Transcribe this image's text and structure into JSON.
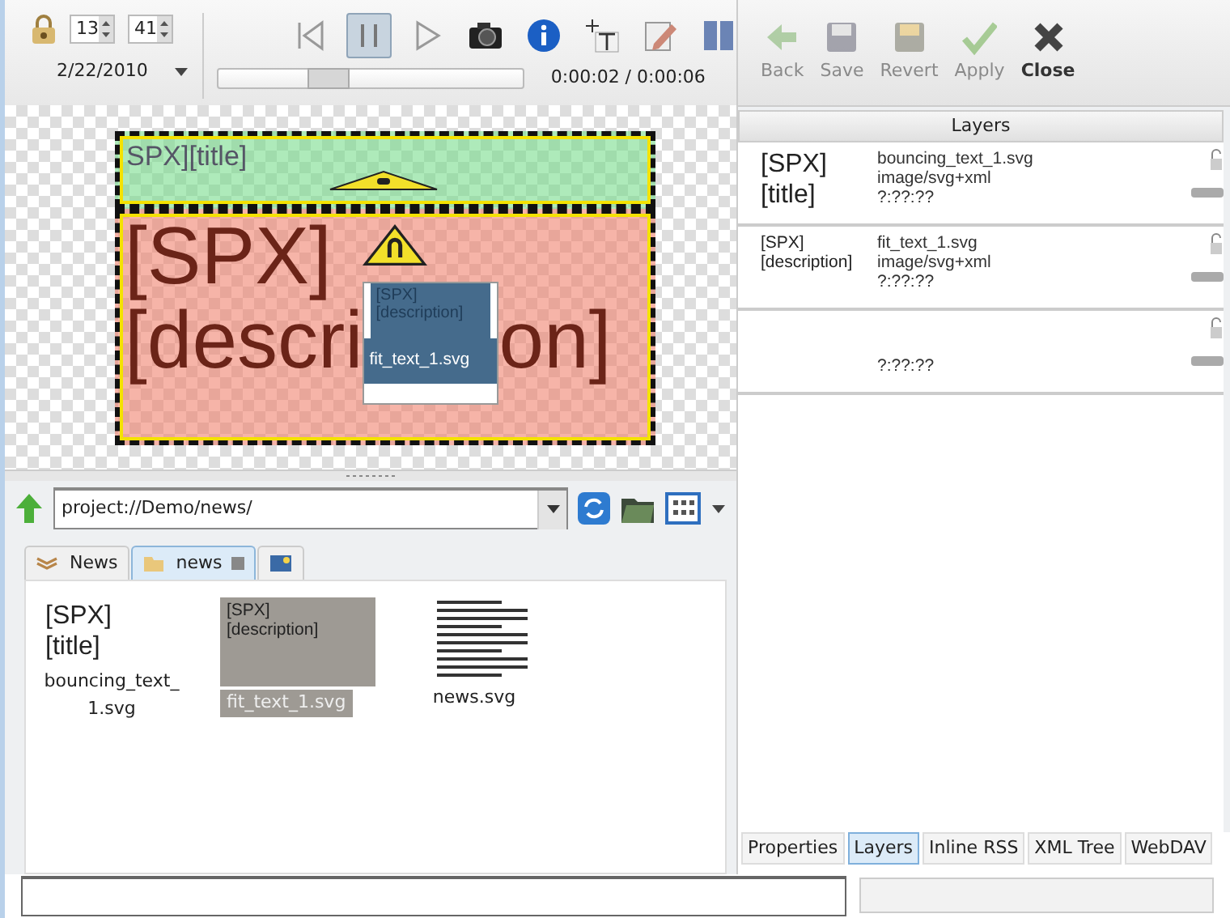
{
  "toolbar": {
    "hour": "13",
    "minute": "41",
    "date": "2/22/2010",
    "buttons": [
      {
        "kind": "skip-back",
        "pressed": false
      },
      {
        "kind": "pause",
        "pressed": true
      },
      {
        "kind": "play",
        "pressed": false
      },
      {
        "kind": "camera",
        "pressed": false
      },
      {
        "kind": "info",
        "pressed": false
      },
      {
        "kind": "add-text",
        "pressed": false
      },
      {
        "kind": "edit",
        "pressed": false
      },
      {
        "kind": "columns",
        "pressed": false
      }
    ],
    "timeline": {
      "level": 0.33
    },
    "time": "0:00:02 / 0:00:06"
  },
  "canvas": {
    "title_text": "SPX][title]",
    "description_line_1": "[SPX]",
    "description_line_2_left": "[descri",
    "description_line_2_right": "on]",
    "popup": {
      "thumb_lines": [
        "[SPX]",
        "[description]"
      ],
      "label": "fit_text_1.svg"
    }
  },
  "browser": {
    "path": "project://Demo/news/",
    "tabs": [
      {
        "kind": "stack",
        "label": "News",
        "selected": false,
        "closable": false
      },
      {
        "kind": "folder",
        "label": "news",
        "selected": true,
        "closable": true
      },
      {
        "kind": "image",
        "selected": false,
        "closable": false
      }
    ],
    "files": [
      {
        "kind": "text",
        "thumb_lines": [
          "[SPX]",
          "[title]"
        ],
        "name": "bouncing_text_1.svg",
        "selected": false
      },
      {
        "kind": "text",
        "thumb_lines": [
          "[SPX]",
          "[description]"
        ],
        "name": "fit_text_1.svg",
        "selected": true
      },
      {
        "kind": "document",
        "name": "news.svg",
        "selected": false
      }
    ]
  },
  "editor_toolbar": [
    {
      "kind": "back",
      "label": "Back",
      "disabled": true
    },
    {
      "kind": "save",
      "label": "Save",
      "disabled": true
    },
    {
      "kind": "revert",
      "label": "Revert",
      "disabled": true
    },
    {
      "kind": "apply",
      "label": "Apply",
      "disabled": true
    },
    {
      "kind": "close",
      "label": "Close",
      "disabled": false
    }
  ],
  "layers": {
    "header": "Layers",
    "rows": [
      {
        "thumb_lines": [
          "[SPX]",
          "[title]"
        ],
        "file": "bouncing_text_1.svg",
        "mime": "image/svg+xml",
        "time": "?:??:??"
      },
      {
        "thumb_lines": [
          "[SPX]",
          "[description]"
        ],
        "file": "fit_text_1.svg",
        "mime": "image/svg+xml",
        "time": "?:??:??"
      },
      {
        "time": "?:??:??"
      }
    ]
  },
  "panel_tabs": [
    {
      "label": "Properties",
      "selected": false
    },
    {
      "label": "Layers",
      "selected": true
    },
    {
      "label": "Inline RSS",
      "selected": false
    },
    {
      "label": "XML Tree",
      "selected": false
    },
    {
      "label": "WebDAV",
      "selected": false
    }
  ]
}
